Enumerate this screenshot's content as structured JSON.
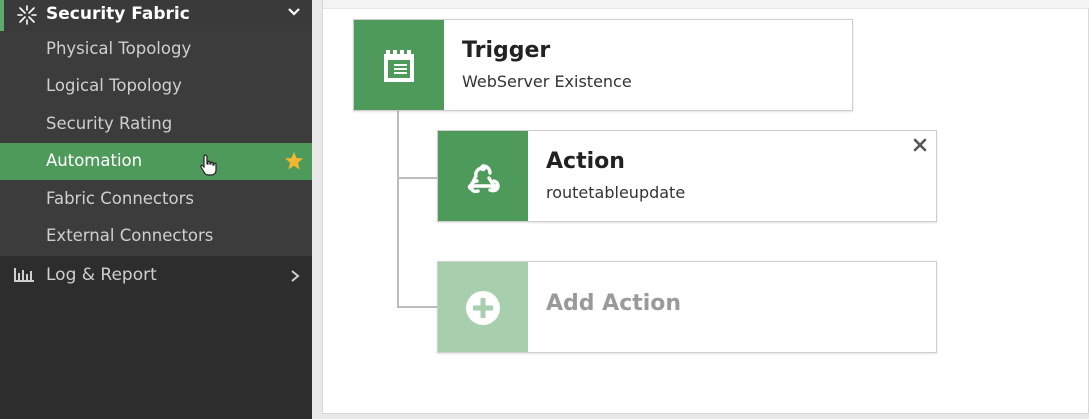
{
  "sidebar": {
    "section": {
      "label": "Security Fabric",
      "icon": "security-fabric-icon"
    },
    "items": [
      {
        "label": "Physical Topology"
      },
      {
        "label": "Logical Topology"
      },
      {
        "label": "Security Rating"
      },
      {
        "label": "Automation",
        "active": true
      },
      {
        "label": "Fabric Connectors"
      },
      {
        "label": "External Connectors"
      }
    ],
    "log_report": {
      "label": "Log & Report",
      "icon": "bar-chart-icon"
    }
  },
  "colors": {
    "sidebar_bg": "#2d2d2d",
    "active_green": "#4e9a5b",
    "card_icon_green": "#4d9a5a",
    "add_icon_green": "#a7cfae",
    "star_yellow": "#f2b731"
  },
  "workflow": {
    "trigger": {
      "title": "Trigger",
      "subtitle": "WebServer Existence",
      "icon": "calendar-icon"
    },
    "action": {
      "title": "Action",
      "subtitle": "routetableupdate",
      "icon": "webhook-icon"
    },
    "add_action": {
      "title": "Add Action",
      "icon": "plus-circle-icon"
    }
  }
}
